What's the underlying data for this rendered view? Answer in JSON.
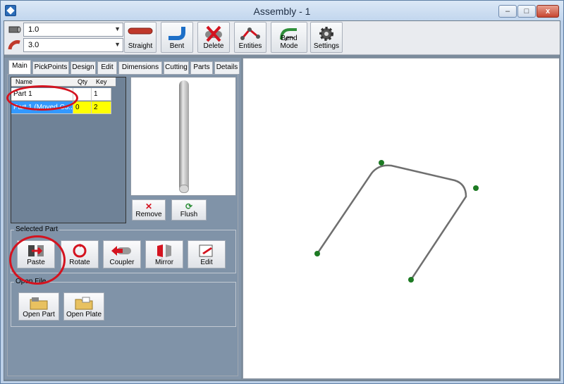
{
  "window": {
    "title": "Assembly - 1",
    "controls": {
      "minimize": "–",
      "maximize": "□",
      "close": "x"
    }
  },
  "toolbar": {
    "diameter_value": "1.0",
    "radius_value": "3.0",
    "buttons": [
      {
        "label": "Straight",
        "icon": "straight-tube-icon"
      },
      {
        "label": "Bent",
        "icon": "bent-tube-icon"
      },
      {
        "label": "Delete",
        "icon": "delete-icon"
      },
      {
        "label": "Entities",
        "icon": "entities-icon"
      },
      {
        "label": "Bend Mode",
        "icon": "bend-mode-icon"
      },
      {
        "label": "Settings",
        "icon": "gear-icon"
      }
    ]
  },
  "tabs": [
    "Main",
    "PickPoints",
    "Design",
    "Edit",
    "Dimensions",
    "Cutting",
    "Parts",
    "Details"
  ],
  "active_tab": "Main",
  "parts_grid": {
    "headers": {
      "name": "Name",
      "qty": "Qty",
      "key": "Key"
    },
    "rows": [
      {
        "name": "Part 1",
        "qty": "",
        "key": "1"
      },
      {
        "name": "Part 1 (Moved Co...",
        "qty": "0",
        "key": "2"
      }
    ]
  },
  "preview_buttons": {
    "remove": "Remove",
    "flush": "Flush"
  },
  "selected_part": {
    "title": "Selected Part",
    "buttons": [
      "Paste",
      "Rotate",
      "Coupler",
      "Mirror",
      "Edit"
    ]
  },
  "open_file": {
    "title": "Open File",
    "buttons": [
      "Open Part",
      "Open Plate"
    ]
  },
  "colors": {
    "annotation": "#d4131f",
    "selection": "#3399ff",
    "highlight": "#ffff00",
    "pickpoint": "#1d7a23"
  }
}
